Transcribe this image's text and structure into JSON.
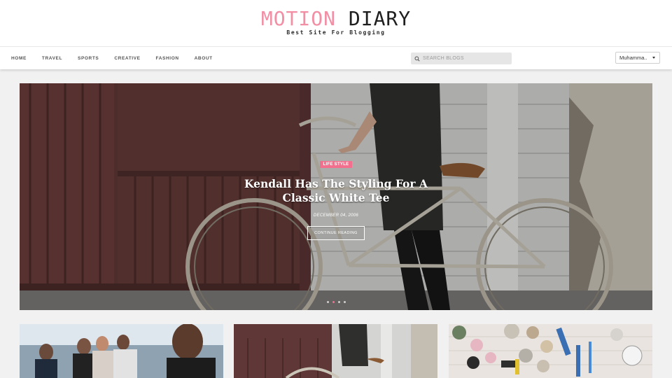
{
  "site": {
    "title_part1": "MOTION",
    "title_part2": "DIARY",
    "tagline": "Best Site For Blogging"
  },
  "nav": {
    "items": [
      "HOME",
      "TRAVEL",
      "SPORTS",
      "CREATIVE",
      "FASHION",
      "ABOUT"
    ]
  },
  "search": {
    "placeholder": "SEARCH BLOGS"
  },
  "user": {
    "name": "Muhamma.."
  },
  "hero": {
    "category": "LIFE STYLE",
    "title_line1": "Kendall Has The Styling For A",
    "title_line2": "Classic White Tee",
    "date": "DECEMBER 04, 2006",
    "button_label": "CONTINUE READING",
    "slide_count": 4,
    "active_slide": 2
  },
  "colors": {
    "accent": "#f28fa5",
    "badge": "#f2708e",
    "dark": "#1f1f1f"
  },
  "icons": {
    "search": "search-icon",
    "user_dropdown": "chevron-down-icon"
  }
}
